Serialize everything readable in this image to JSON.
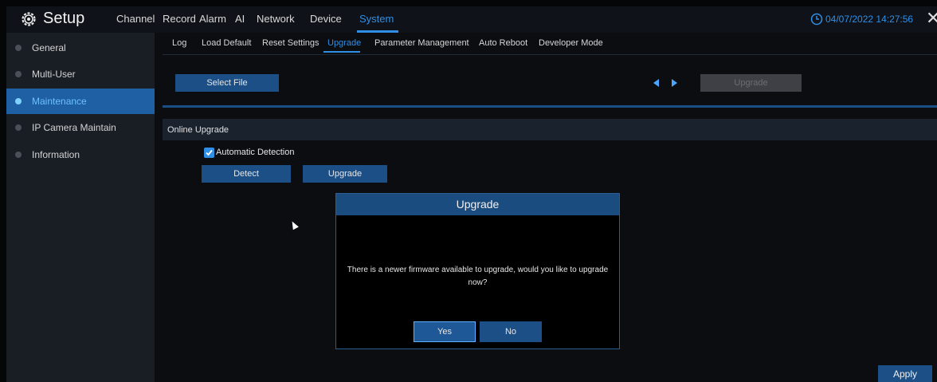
{
  "header": {
    "title": "Setup",
    "menu": [
      "Channel",
      "Record",
      "Alarm",
      "AI",
      "Network",
      "Device",
      "System"
    ],
    "active_menu": "System",
    "datetime": "04/07/2022 14:27:56",
    "close_glyph": "✕"
  },
  "sidebar": {
    "items": [
      {
        "label": "General",
        "active": false
      },
      {
        "label": "Multi-User",
        "active": false
      },
      {
        "label": "Maintenance",
        "active": true
      },
      {
        "label": "IP Camera Maintain",
        "active": false
      },
      {
        "label": "Information",
        "active": false
      }
    ]
  },
  "subtabs": {
    "items": [
      "Log",
      "Load Default",
      "Reset Settings",
      "Upgrade",
      "Parameter Management",
      "Auto Reboot",
      "Developer Mode"
    ],
    "active": "Upgrade"
  },
  "local_upgrade": {
    "select_file_label": "Select File",
    "upgrade_label": "Upgrade"
  },
  "online_upgrade": {
    "section_title": "Online Upgrade",
    "auto_detect_label": "Automatic Detection",
    "auto_detect_checked": true,
    "detect_label": "Detect",
    "upgrade_label": "Upgrade"
  },
  "dialog": {
    "title": "Upgrade",
    "message": "There is a newer firmware available to upgrade,  would you like to upgrade now?",
    "yes_label": "Yes",
    "no_label": "No"
  },
  "footer": {
    "apply_label": "Apply"
  },
  "icons": {
    "header": "gear-icon",
    "clock": "clock-icon",
    "prev": "arrow-left-icon",
    "next": "arrow-right-icon",
    "check": "checkmark-icon"
  },
  "colors": {
    "accent": "#2f8fe6",
    "button": "#1c4f86",
    "sidebar_active": "#1f5fa3"
  }
}
